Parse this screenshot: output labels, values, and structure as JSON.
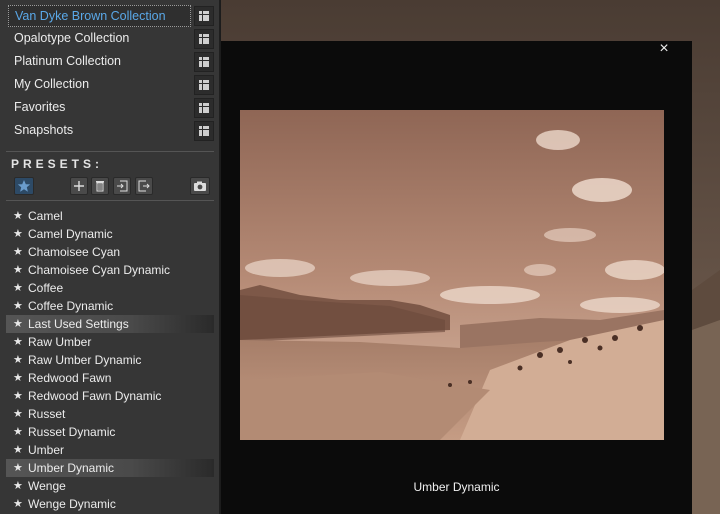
{
  "collections": [
    {
      "label": "Van Dyke Brown Collection",
      "selected": true
    },
    {
      "label": "Opalotype Collection"
    },
    {
      "label": "Platinum Collection"
    },
    {
      "label": "My Collection"
    },
    {
      "label": "Favorites"
    },
    {
      "label": "Snapshots"
    }
  ],
  "presets_heading": "PRESETS:",
  "toolbar_icons": [
    "star-icon",
    "add-icon",
    "trash-icon",
    "import-icon",
    "export-icon",
    "camera-icon"
  ],
  "presets": [
    {
      "label": "Camel"
    },
    {
      "label": "Camel Dynamic"
    },
    {
      "label": "Chamoisee Cyan"
    },
    {
      "label": "Chamoisee Cyan Dynamic"
    },
    {
      "label": "Coffee"
    },
    {
      "label": "Coffee Dynamic"
    },
    {
      "label": "Last Used Settings",
      "highlight": true
    },
    {
      "label": "Raw Umber"
    },
    {
      "label": "Raw Umber Dynamic"
    },
    {
      "label": "Redwood Fawn"
    },
    {
      "label": "Redwood Fawn Dynamic"
    },
    {
      "label": "Russet"
    },
    {
      "label": "Russet Dynamic"
    },
    {
      "label": "Umber"
    },
    {
      "label": "Umber Dynamic",
      "highlight": true
    },
    {
      "label": "Wenge"
    },
    {
      "label": "Wenge Dynamic"
    }
  ],
  "star_glyph": "★",
  "modal": {
    "close_glyph": "×",
    "caption": "Umber Dynamic"
  },
  "colors": {
    "selected_collection_text": "#5aa8e8",
    "panel_bg": "#363636",
    "modal_bg": "#0b0b0b",
    "sepia_tone": "#a07a66"
  }
}
